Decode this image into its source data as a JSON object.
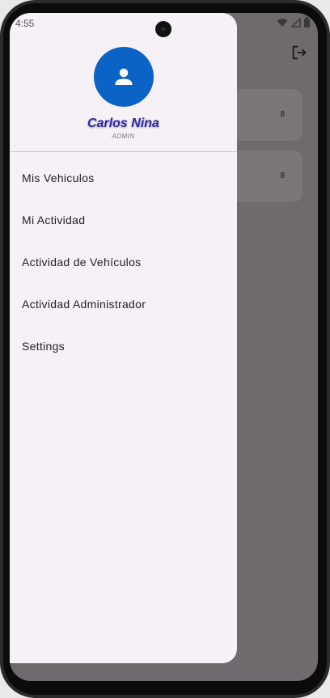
{
  "status_bar": {
    "time": "4:55"
  },
  "background_app": {
    "cards": [
      {
        "count": "8"
      },
      {
        "count": "8"
      }
    ]
  },
  "drawer": {
    "user": {
      "name": "Carlos Nina",
      "role": "ADMIN"
    },
    "menu_items": [
      {
        "label": "Mis Vehiculos"
      },
      {
        "label": "Mi Actividad"
      },
      {
        "label": "Actividad de Vehículos"
      },
      {
        "label": "Actividad Administrador"
      },
      {
        "label": "Settings"
      }
    ]
  },
  "colors": {
    "avatar": "#0b63c5",
    "user_name": "#2a2ca8",
    "drawer_bg": "#f6f0f7",
    "scrim": "#6e6a6e"
  },
  "icons": [
    "person-icon",
    "logout-icon",
    "wifi-icon",
    "signal-icon",
    "battery-icon"
  ]
}
